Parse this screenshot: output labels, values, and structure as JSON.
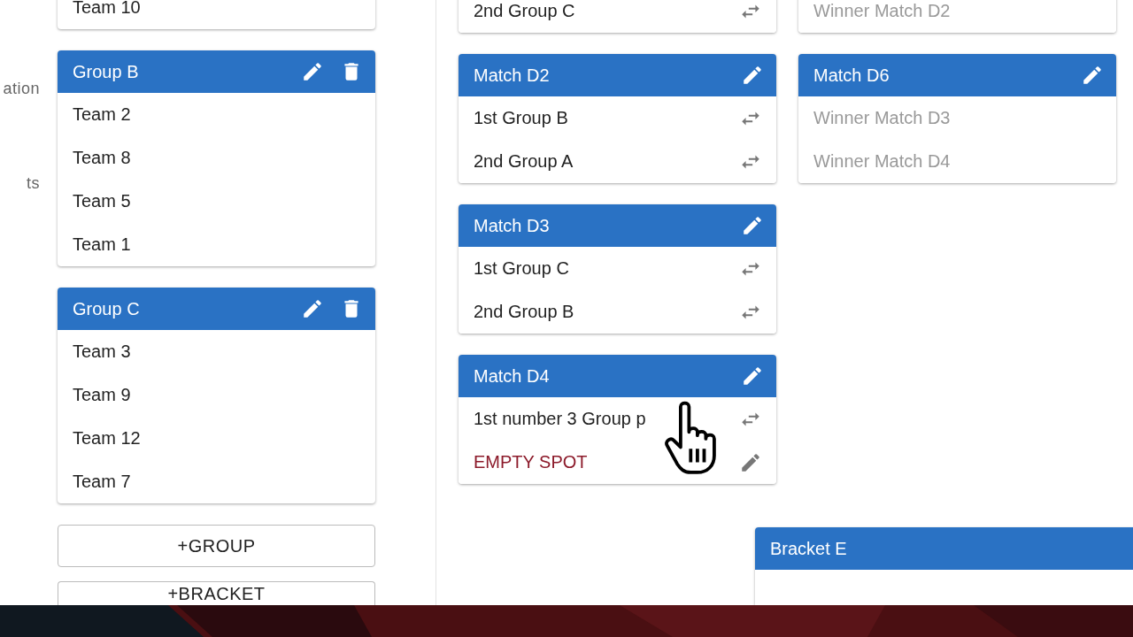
{
  "sidebar": {
    "items": [
      {
        "label": "ation"
      },
      {
        "label": "ts"
      }
    ]
  },
  "groups": [
    {
      "teams": [
        "Team 10"
      ]
    },
    {
      "title": "Group B",
      "editable": true,
      "deletable": true,
      "teams": [
        "Team 2",
        "Team 8",
        "Team 5",
        "Team 1"
      ]
    },
    {
      "title": "Group C",
      "editable": true,
      "deletable": true,
      "teams": [
        "Team 3",
        "Team 9",
        "Team 12",
        "Team 7"
      ]
    }
  ],
  "buttons": [
    {
      "label": "+GROUP"
    },
    {
      "label": "+BRACKET"
    }
  ],
  "match_columns": [
    [
      {
        "slots": [
          {
            "text": "2nd Group C",
            "kind": "team",
            "swappable": true,
            "editable": false
          }
        ]
      },
      {
        "title": "Match D2",
        "editable": true,
        "slots": [
          {
            "text": "1st Group B",
            "kind": "team",
            "swappable": true,
            "editable": false
          },
          {
            "text": "2nd Group A",
            "kind": "team",
            "swappable": true,
            "editable": false
          }
        ]
      },
      {
        "title": "Match D3",
        "editable": true,
        "slots": [
          {
            "text": "1st Group C",
            "kind": "team",
            "swappable": true,
            "editable": false
          },
          {
            "text": "2nd Group B",
            "kind": "team",
            "swappable": true,
            "editable": false
          }
        ]
      },
      {
        "title": "Match D4",
        "editable": true,
        "slots": [
          {
            "text": "1st number 3 Group p",
            "kind": "team",
            "swappable": true,
            "editable": false
          },
          {
            "text": "EMPTY SPOT",
            "kind": "empty",
            "swappable": false,
            "editable": true
          }
        ]
      }
    ],
    [
      {
        "slots": [
          {
            "text": "Winner Match D2",
            "kind": "pending",
            "swappable": false,
            "editable": false
          }
        ]
      },
      {
        "title": "Match D6",
        "editable": true,
        "slots": [
          {
            "text": "Winner Match D3",
            "kind": "pending",
            "swappable": false,
            "editable": false
          },
          {
            "text": "Winner Match D4",
            "kind": "pending",
            "swappable": false,
            "editable": false
          }
        ]
      }
    ]
  ],
  "bracket": {
    "title": "Bracket E"
  }
}
